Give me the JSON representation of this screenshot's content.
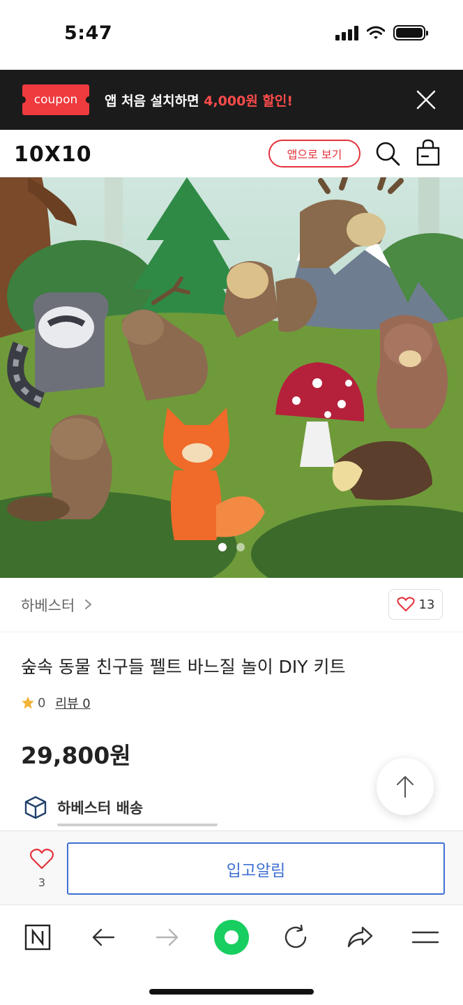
{
  "status_bar": {
    "time": "5:47"
  },
  "coupon_banner": {
    "badge": "coupon",
    "text_prefix": "앱 처음 설치하면 ",
    "text_highlight": "4,000원 할인!",
    "highlight_color": "#ff4b4b",
    "badge_color": "#ef3a3e"
  },
  "header": {
    "logo": "10X10",
    "app_view_label": "앱으로 보기",
    "accent": "#e3323b"
  },
  "gallery": {
    "image_count": 2,
    "active_index": 0
  },
  "brand": {
    "name": "하베스터",
    "like_count": "13"
  },
  "product": {
    "title": "숲속 동물 친구들 펠트 바느질 놀이 DIY 키트",
    "rating": "0",
    "review_label": "리뷰 0",
    "price": "29,800원",
    "shipping_label": "하베스터 배송"
  },
  "buy_bar": {
    "wish_count": "3",
    "restock_label": "입고알림",
    "button_color": "#3d6fd1"
  },
  "browser_toolbar": {
    "items": [
      "naver-tab-icon",
      "back-arrow-icon",
      "forward-arrow-icon",
      "green-dot-icon",
      "reload-icon",
      "share-icon",
      "menu-icon"
    ],
    "green": "#19ce60"
  }
}
